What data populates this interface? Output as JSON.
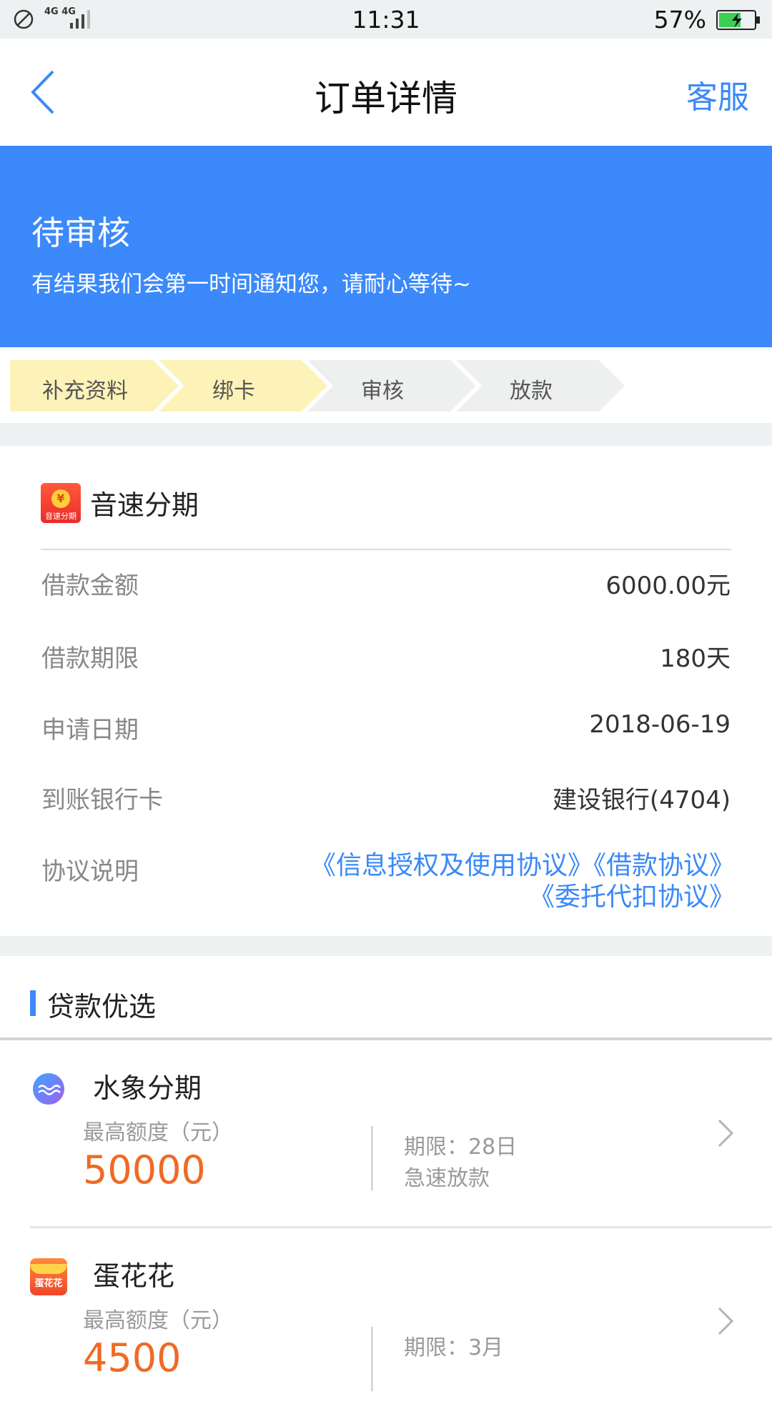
{
  "status_bar": {
    "network": "4G 4G",
    "time": "11:31",
    "battery": "57%"
  },
  "header": {
    "title": "订单详情",
    "right_action": "客服"
  },
  "banner": {
    "title": "待审核",
    "subtitle": "有结果我们会第一时间通知您，请耐心等待~",
    "color": "#3b89fa"
  },
  "steps": [
    {
      "label": "补充资料",
      "done": true
    },
    {
      "label": "绑卡",
      "done": true
    },
    {
      "label": "审核",
      "done": false
    },
    {
      "label": "放款",
      "done": false
    }
  ],
  "order": {
    "product_name": "音速分期",
    "product_logo_text": "音速分期",
    "rows": [
      {
        "label": "借款金额",
        "value": "6000.00元"
      },
      {
        "label": "借款期限",
        "value": "180天"
      },
      {
        "label": "申请日期",
        "value": "2018-06-19"
      },
      {
        "label": "到账银行卡",
        "value": "建设银行(4704)"
      }
    ],
    "agreement_label": "协议说明",
    "agreements": [
      "《信息授权及使用协议》",
      "《借款协议》",
      "《委托代扣协议》"
    ]
  },
  "recommend": {
    "title": "贷款优选",
    "items": [
      {
        "name": "水象分期",
        "limit_label": "最高额度（元）",
        "amount": "50000",
        "term": "期限：28日",
        "tag": "急速放款"
      },
      {
        "name": "蛋花花",
        "logo_text": "蛋花花",
        "limit_label": "最高额度（元）",
        "amount": "4500",
        "term": "期限：3月",
        "tag": ""
      }
    ]
  },
  "colors": {
    "accent": "#3a89f8",
    "step_done": "#fdf3b8",
    "step_todo": "#eef0f0",
    "amount": "#f06a24"
  }
}
